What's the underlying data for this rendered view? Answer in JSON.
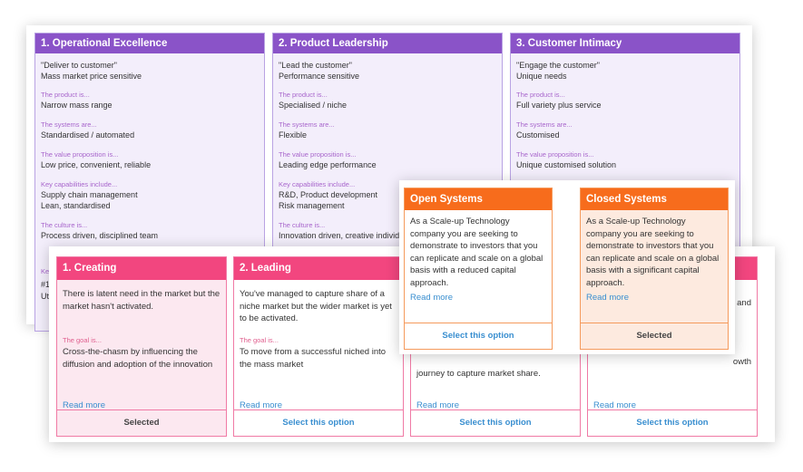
{
  "strategies": [
    {
      "title": "1. Operational Excellence",
      "quote": "\"Deliver to customer\"",
      "summary": "Mass market price sensitive",
      "product_label": "The product is...",
      "product": "Narrow mass range",
      "systems_label": "The systems are...",
      "systems": "Standardised / automated",
      "value_label": "The value proposition is...",
      "value": "Low price, convenient, reliable",
      "capabilities_label": "Key capabilities include...",
      "capabilities_1": "Supply chain management",
      "capabilities_2": "Lean, standardised",
      "culture_label": "The culture is...",
      "culture": "Process driven, disciplined team",
      "fragment_1": "Ke",
      "fragment_2": "#1",
      "fragment_3": "Ut"
    },
    {
      "title": "2. Product Leadership",
      "quote": "\"Lead the customer\"",
      "summary": "Performance sensitive",
      "product_label": "The product is...",
      "product": "Specialised / niche",
      "systems_label": "The systems are...",
      "systems": "Flexible",
      "value_label": "The value proposition is...",
      "value": "Leading edge performance",
      "capabilities_label": "Key capabilities include...",
      "capabilities_1": "R&D, Product development",
      "capabilities_2": "Risk management",
      "culture_label": "The culture is...",
      "culture": "Innovation driven, creative individ"
    },
    {
      "title": "3. Customer Intimacy",
      "quote": "\"Engage the customer\"",
      "summary": "Unique needs",
      "product_label": "The product is...",
      "product": "Full variety plus service",
      "systems_label": "The systems are...",
      "systems": "Customised",
      "value_label": "The value proposition is...",
      "value": "Unique customised solution"
    }
  ],
  "stages": [
    {
      "title": "1. Creating",
      "description": "There is latent need in the market but the market hasn't activated.",
      "goal_label": "The goal is...",
      "goal": "Cross-the-chasm by influencing the diffusion and adoption of the innovation",
      "read_more": "Read more",
      "action": "Selected"
    },
    {
      "title": "2. Leading",
      "description": "You've managed to capture share of a niche market but the wider market is yet to be activated.",
      "goal_label": "The goal is...",
      "goal": "To move from a successful niched into the mass market",
      "read_more": "Read more",
      "action": "Select this option"
    },
    {
      "title": "",
      "description": "",
      "goal_label": "",
      "goal": "journey to capture market share.",
      "read_more": "Read more",
      "action": "Select this option"
    },
    {
      "title": "",
      "description": "d and",
      "goal_label": "",
      "goal": "owth",
      "read_more": "Read more",
      "action": "Select this option"
    }
  ],
  "systems": [
    {
      "title": "Open Systems",
      "description": "As a Scale-up Technology company you are seeking to demonstrate to investors that you can replicate and scale on a global basis with a reduced capital approach.",
      "read_more": "Read more",
      "action": "Select this option"
    },
    {
      "title": "Closed Systems",
      "description": "As a Scale-up Technology company you are seeking to demonstrate to investors that you can replicate and scale on a global basis with a significant capital approach.",
      "read_more": "Read more",
      "action": "Selected"
    }
  ],
  "colors": {
    "strategy_accent": "#8a53c8",
    "stage_accent": "#f2467f",
    "system_accent": "#f76c1c",
    "link": "#3a8fd0"
  }
}
